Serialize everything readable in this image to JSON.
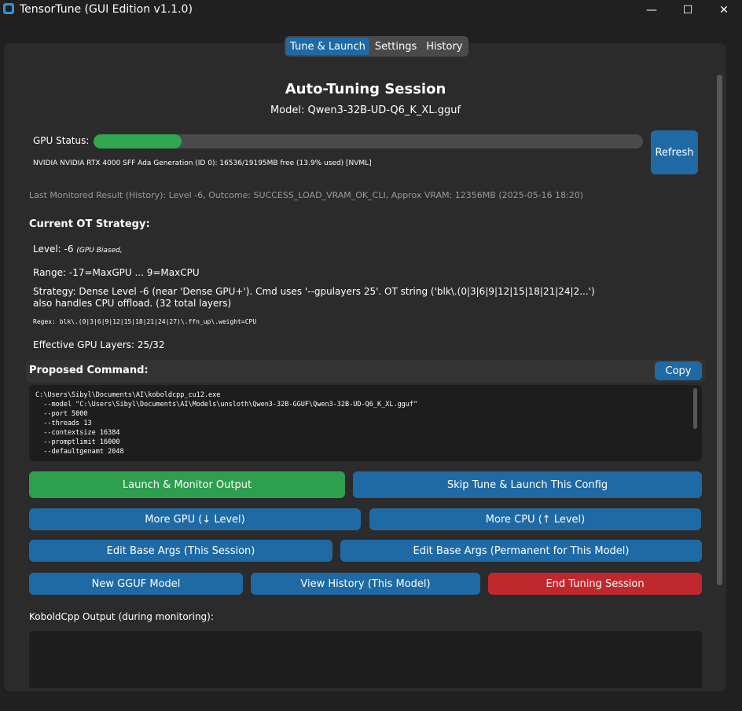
{
  "window": {
    "title": "TensorTune (GUI Edition v1.1.0)",
    "controls": {
      "minimize": "—",
      "maximize": "☐",
      "close": "✕"
    }
  },
  "tabs": [
    {
      "label": "Tune & Launch",
      "active": true
    },
    {
      "label": "Settings",
      "active": false
    },
    {
      "label": "History",
      "active": false
    }
  ],
  "session": {
    "title": "Auto-Tuning Session",
    "model": "Model: Qwen3-32B-UD-Q6_K_XL.gguf"
  },
  "gpu": {
    "label": "GPU Status:",
    "usage_fraction": 0.139,
    "detail": "NVIDIA NVIDIA RTX 4000 SFF Ada Generation (ID 0): 16536/19195MB free (13.9% used) [NVML]",
    "refresh_label": "Refresh"
  },
  "last_result": "Last Monitored Result (History): Level -6, Outcome: SUCCESS_LOAD_VRAM_OK_CLI, Approx VRAM: 12356MB (2025-05-16 18:20)",
  "strategy": {
    "title": "Current OT Strategy:",
    "level": "Level: -6",
    "level_note": "(GPU Biased,",
    "range": "Range: -17=MaxGPU ... 9=MaxCPU",
    "desc1": "Strategy: Dense Level -6 (near 'Dense GPU+'). Cmd uses '--gpulayers 25'. OT string ('blk\\.(0|3|6|9|12|15|18|21|24|2...')",
    "desc2": "also handles CPU offload. (32 total layers)",
    "regex": "Regex: blk\\.(0|3|6|9|12|15|18|21|24|27)\\.ffn_up\\.weight=CPU",
    "effective": "Effective GPU Layers: 25/32"
  },
  "command": {
    "title": "Proposed Command:",
    "copy_label": "Copy",
    "text": "C:\\Users\\Sibyl\\Documents\\AI\\koboldcpp_cu12.exe\n  --model \"C:\\Users\\Sibyl\\Documents\\AI\\Models\\unsloth\\Qwen3-32B-GGUF\\Qwen3-32B-UD-Q6_K_XL.gguf\"\n  --port 5000\n  --threads 13\n  --contextsize 16384\n  --promptlimit 16000\n  --defaultgenamt 2048"
  },
  "actions": {
    "launch_monitor": "Launch & Monitor Output",
    "skip_tune": "Skip Tune & Launch This Config",
    "more_gpu": "More GPU (↓ Level)",
    "more_cpu": "More CPU (↑ Level)",
    "edit_base_session": "Edit Base Args (This Session)",
    "edit_base_permanent": "Edit Base Args (Permanent for This Model)",
    "new_gguf": "New GGUF Model",
    "view_history": "View History (This Model)",
    "end_session": "End Tuning Session"
  },
  "output": {
    "label": "KoboldCpp Output (during monitoring):"
  },
  "colors": {
    "accent": "#1f6aa5",
    "success": "#2e9e4f",
    "danger": "#c1282d",
    "gpu_bar": "#2fa84f"
  }
}
